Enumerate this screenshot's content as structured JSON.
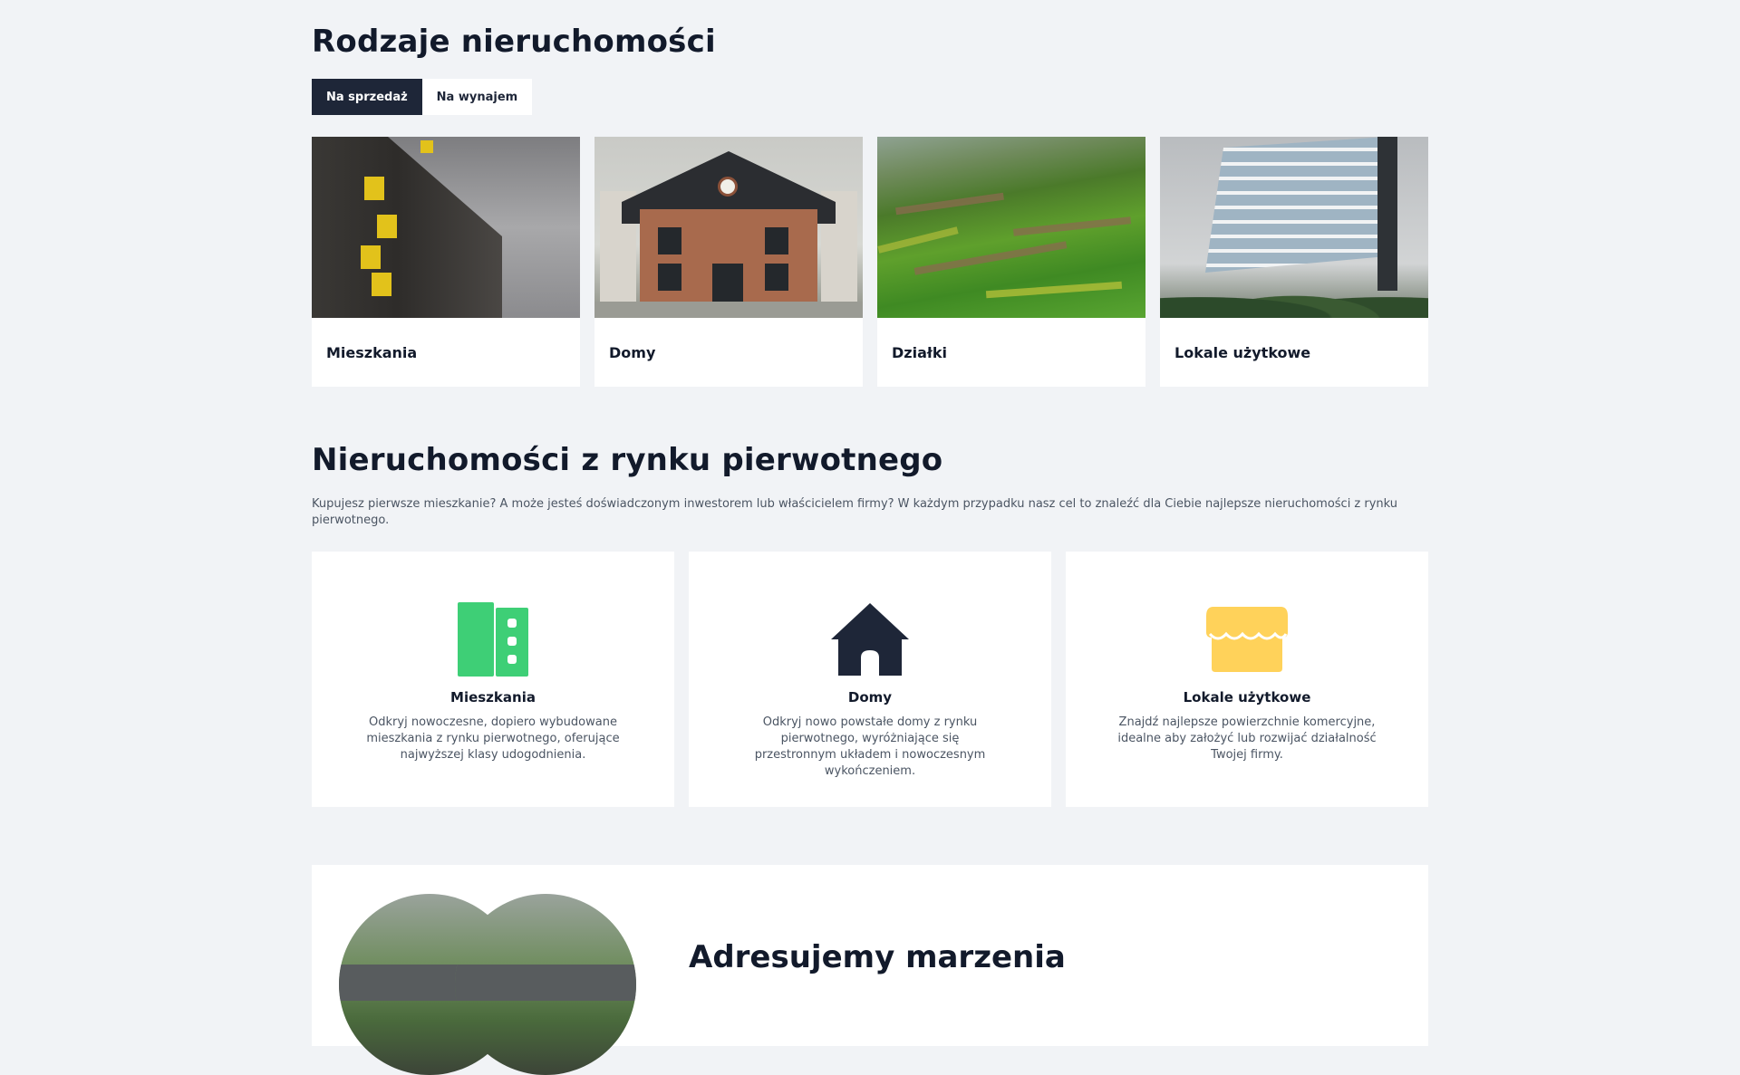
{
  "types_section": {
    "title": "Rodzaje nieruchomości",
    "tabs": [
      {
        "label": "Na sprzedaż",
        "active": true
      },
      {
        "label": "Na wynajem",
        "active": false
      }
    ],
    "cards": [
      {
        "label": "Mieszkania"
      },
      {
        "label": "Domy"
      },
      {
        "label": "Działki"
      },
      {
        "label": "Lokale użytkowe"
      }
    ]
  },
  "primary_section": {
    "title": "Nieruchomości z rynku pierwotnego",
    "description": "Kupujesz pierwsze mieszkanie? A może jesteś doświadczonym inwestorem lub właścicielem firmy? W każdym przypadku nasz cel to znaleźć dla Ciebie najlepsze nieruchomości z rynku pierwotnego.",
    "cards": [
      {
        "icon": "apartment-building-icon",
        "icon_color": "#3ecf76",
        "title": "Mieszkania",
        "description": "Odkryj nowoczesne, dopiero wybudowane mieszkania z rynku pierwotnego, oferujące najwyższej klasy udogodnienia."
      },
      {
        "icon": "house-icon",
        "icon_color": "#1e2638",
        "title": "Domy",
        "description": "Odkryj nowo powstałe domy z rynku pierwotnego, wyróżniające się przestronnym układem i nowoczesnym wykończeniem."
      },
      {
        "icon": "storefront-icon",
        "icon_color": "#ffd25a",
        "title": "Lokale użytkowe",
        "description": "Znajdź najlepsze powierzchnie komercyjne, idealne aby założyć lub rozwijać działalność Twojej firmy."
      }
    ]
  },
  "dream_section": {
    "title": "Adresujemy marzenia"
  }
}
